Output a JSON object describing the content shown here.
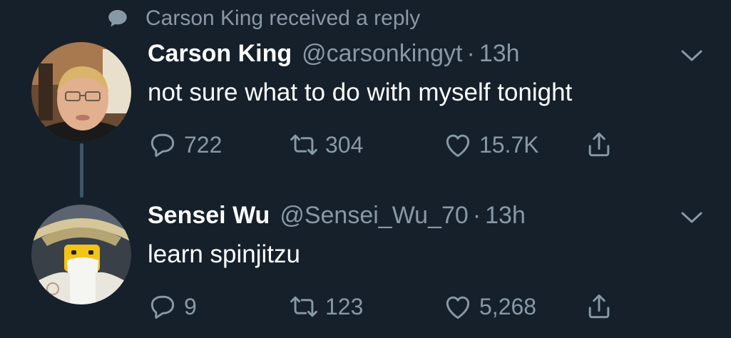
{
  "context": {
    "icon": "speech-bubble-icon",
    "text": "Carson King received a reply"
  },
  "tweets": [
    {
      "name": "Carson King",
      "handle": "@carsonkingyt",
      "separator": "·",
      "time": "13h",
      "text": "not sure what to do with myself tonight",
      "reply_count": "722",
      "retweet_count": "304",
      "like_count": "15.7K",
      "avatar": "person-photo"
    },
    {
      "name": "Sensei Wu",
      "handle": "@Sensei_Wu_70",
      "separator": "·",
      "time": "13h",
      "text": "learn spinjitzu",
      "reply_count": "9",
      "retweet_count": "123",
      "like_count": "5,268",
      "avatar": "lego-figure-photo"
    }
  ],
  "colors": {
    "background": "#15202b",
    "secondary_text": "#8899a6",
    "primary_text": "#ffffff",
    "thread_line": "#3d5466"
  }
}
